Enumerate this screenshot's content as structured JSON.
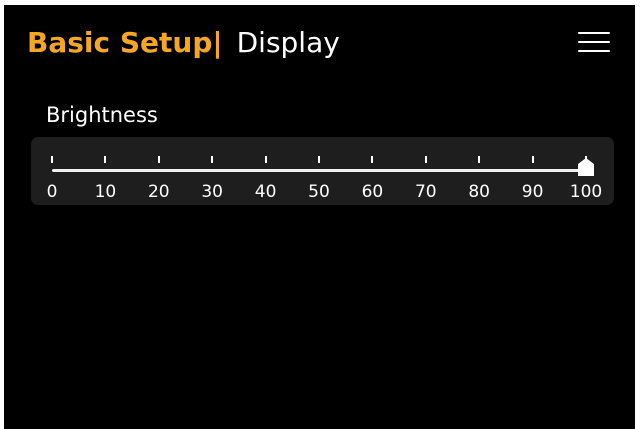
{
  "header": {
    "section": "Basic Setup",
    "separator": "|",
    "page": "Display"
  },
  "menu": {
    "icon": "hamburger-menu-icon"
  },
  "brightness": {
    "label": "Brightness",
    "min": 0,
    "max": 100,
    "value": 100,
    "ticks": [
      "0",
      "10",
      "20",
      "30",
      "40",
      "50",
      "60",
      "70",
      "80",
      "90",
      "100"
    ]
  },
  "colors": {
    "accent": "#f5a623",
    "background": "#000000",
    "panel": "#1e1e1e",
    "text": "#ffffff"
  }
}
